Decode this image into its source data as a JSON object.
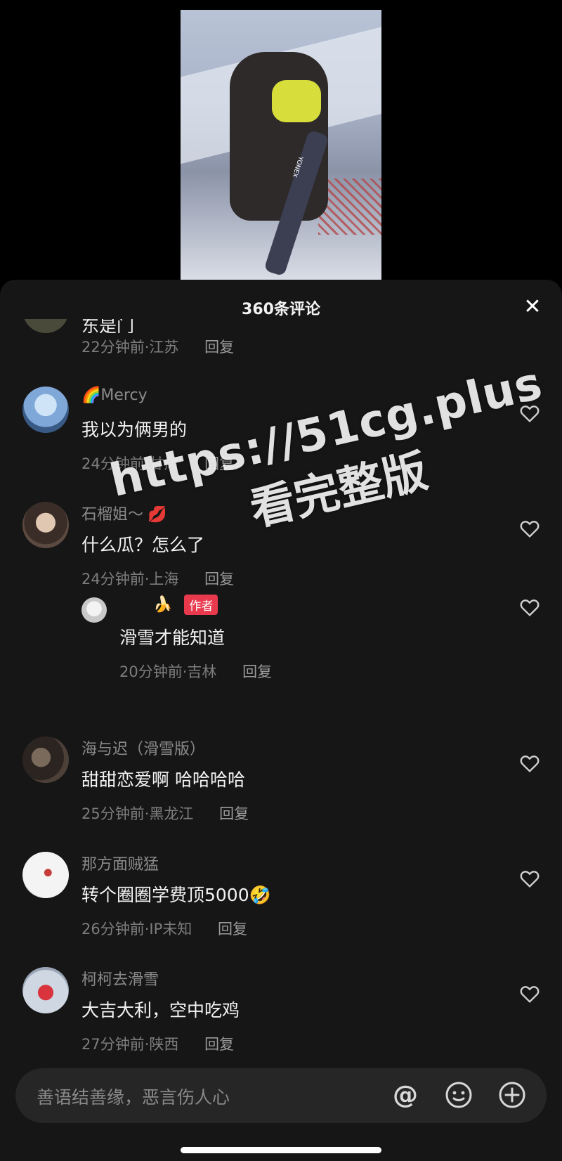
{
  "video": {
    "board_brand": "YONEX"
  },
  "sheet": {
    "title": "360条评论",
    "close_glyph": "✕"
  },
  "comments": [
    {
      "name": "",
      "text": "东是门",
      "time": "22分钟前",
      "location": "江苏",
      "reply": "回复"
    },
    {
      "name": "Mercy",
      "name_prefix": "🌈",
      "text": "我以为俩男的",
      "time": "24分钟前",
      "location": "甘肃",
      "reply": "回复"
    },
    {
      "name": "石榴姐～",
      "name_suffix": "💋",
      "text": "什么瓜？怎么了",
      "time": "24分钟前",
      "location": "上海",
      "reply": "回复"
    },
    {
      "name": "🍌",
      "badge": "作者",
      "text": "滑雪才能知道",
      "time": "20分钟前",
      "location": "吉林",
      "reply": "回复"
    },
    {
      "name": "海与迟（滑雪版）",
      "text": "甜甜恋爱啊 哈哈哈哈",
      "time": "25分钟前",
      "location": "黑龙江",
      "reply": "回复"
    },
    {
      "name": "那方面贼猛",
      "text": "转个圈圈学费顶5000🤣",
      "time": "26分钟前",
      "location": "IP未知",
      "reply": "回复"
    },
    {
      "name": "柯柯去滑雪",
      "text": "大吉大利，空中吃鸡",
      "time": "27分钟前",
      "location": "陕西",
      "reply": "回复"
    }
  ],
  "watermark": {
    "line1": "https://51cg.plus",
    "line2": "看完整版"
  },
  "input": {
    "placeholder": "善语结善缘，恶言伤人心"
  },
  "icons": {
    "mention": "@",
    "emoji": "emoji-icon",
    "add": "+"
  },
  "colors": {
    "sheet_bg": "#161616",
    "author_badge": "#e8394d",
    "input_bg": "#262626"
  }
}
